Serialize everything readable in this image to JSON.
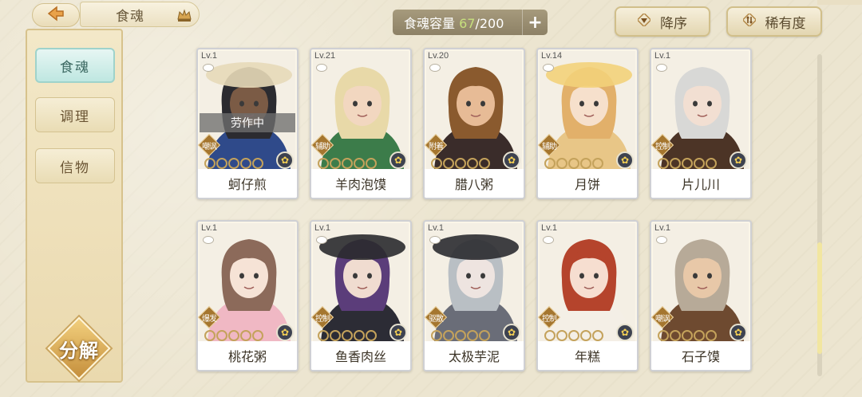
{
  "header": {
    "tab_label": "食魂",
    "capacity_label": "食魂容量",
    "capacity_current": "67",
    "capacity_max": "/200",
    "add_label": "+"
  },
  "sort": {
    "order_label": "降序",
    "rarity_label": "稀有度"
  },
  "sidebar": {
    "items": [
      {
        "label": "食魂"
      },
      {
        "label": "调理"
      },
      {
        "label": "信物"
      }
    ],
    "decompose_label": "分解"
  },
  "cards": [
    {
      "level": "Lv.1",
      "name": "蚵仔煎",
      "role": "嘲讽",
      "stars": 0,
      "status": "劳作中",
      "hair": "#2b2b30",
      "skin": "#7b5b45",
      "outfit": "#2f4a8a",
      "hat": "#e7d9b8"
    },
    {
      "level": "Lv.21",
      "name": "羊肉泡馍",
      "role": "辅助",
      "stars": 0,
      "status": "",
      "hair": "#e8d9a8",
      "skin": "#f2d7c0",
      "outfit": "#3c7c4a",
      "hat": ""
    },
    {
      "level": "Lv.20",
      "name": "腊八粥",
      "role": "附着",
      "stars": 0,
      "status": "",
      "hair": "#8a5a2e",
      "skin": "#e7bb96",
      "outfit": "#3a2c2a",
      "hat": ""
    },
    {
      "level": "Lv.14",
      "name": "月饼",
      "role": "辅助",
      "stars": 0,
      "status": "",
      "hair": "#e2b06a",
      "skin": "#f6e0cc",
      "outfit": "#e8c687",
      "hat": "#f3d27a"
    },
    {
      "level": "Lv.1",
      "name": "片儿川",
      "role": "控制",
      "stars": 0,
      "status": "",
      "hair": "#d8d8d6",
      "skin": "#f2dfd2",
      "outfit": "#4c3426",
      "hat": ""
    },
    {
      "level": "Lv.1",
      "name": "桃花粥",
      "role": "爆发",
      "stars": 0,
      "status": "",
      "hair": "#8c6a5a",
      "skin": "#f6e3d6",
      "outfit": "#f0b8c4",
      "hat": ""
    },
    {
      "level": "Lv.1",
      "name": "鱼香肉丝",
      "role": "控制",
      "stars": 0,
      "status": "",
      "hair": "#5b3d7a",
      "skin": "#f0dcd0",
      "outfit": "#2c2c35",
      "hat": "#2a2a2e"
    },
    {
      "level": "Lv.1",
      "name": "太极芋泥",
      "role": "驱散",
      "stars": 0,
      "status": "",
      "hair": "#b9bfc4",
      "skin": "#eee4e0",
      "outfit": "#6a6d78",
      "hat": "#2b2b30"
    },
    {
      "level": "Lv.1",
      "name": "年糕",
      "role": "控制",
      "stars": 0,
      "status": "",
      "hair": "#b5442c",
      "skin": "#f6ded0",
      "outfit": "#f4efe6",
      "hat": ""
    },
    {
      "level": "Lv.1",
      "name": "石子馍",
      "role": "嘲讽",
      "stars": 0,
      "status": "",
      "hair": "#b7aa98",
      "skin": "#e8c8a8",
      "outfit": "#6e4a30",
      "hat": ""
    }
  ],
  "colors": {
    "capacity_current": "#c7e07d",
    "active_tab": "#bfe7e1",
    "role_badge": "#a5762f",
    "star": "#e6c66a"
  },
  "icons": {
    "back": "back-arrow-icon",
    "tab": "crown-icon",
    "sort_order": "triangle-down-icon",
    "sort_rarity": "sort-arrows-icon",
    "element": "flower-icon"
  }
}
